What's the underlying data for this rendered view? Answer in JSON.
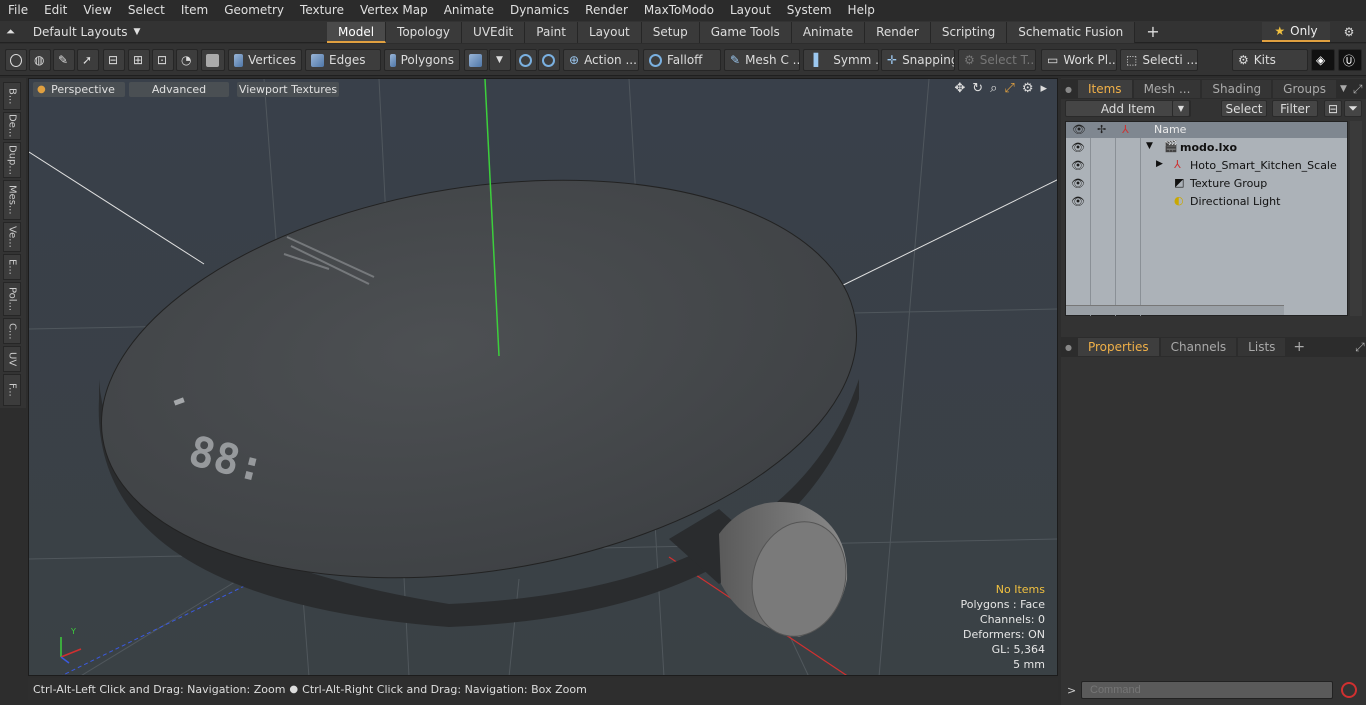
{
  "menu": [
    "File",
    "Edit",
    "View",
    "Select",
    "Item",
    "Geometry",
    "Texture",
    "Vertex Map",
    "Animate",
    "Dynamics",
    "Render",
    "MaxToModo",
    "Layout",
    "System",
    "Help"
  ],
  "layout": {
    "label": "Default Layouts"
  },
  "tabs": [
    "Model",
    "Topology",
    "UVEdit",
    "Paint",
    "Layout",
    "Setup",
    "Game Tools",
    "Animate",
    "Render",
    "Scripting",
    "Schematic Fusion"
  ],
  "only_label": "Only",
  "toolbar": {
    "vertices": "Vertices",
    "edges": "Edges",
    "polygons": "Polygons",
    "action": "Action ...",
    "falloff": "Falloff",
    "mesh": "Mesh C ...",
    "symm": "Symm ...",
    "snapping": "Snapping",
    "select_t": "Select T...",
    "work_plane": "Work Pl...",
    "selecti": "Selecti ...",
    "kits": "Kits"
  },
  "left_tabs": [
    "B...",
    "De...",
    "Dup...",
    "Mes...",
    "Ve...",
    "E...",
    "Pol...",
    "C...",
    "UV",
    "F..."
  ],
  "viewport": {
    "perspective": "Perspective",
    "advanced": "Advanced",
    "textures": "Viewport Textures",
    "info": {
      "no_items": "No Items",
      "polygons": "Polygons : Face",
      "channels": "Channels: 0",
      "deformers": "Deformers: ON",
      "gl": "GL: 5,364",
      "unit": "5 mm"
    },
    "display_text": "88:"
  },
  "status": {
    "left": "Ctrl-Alt-Left Click and Drag: Navigation: Zoom",
    "right": "Ctrl-Alt-Right Click and Drag: Navigation: Box Zoom"
  },
  "items_panel": {
    "tabs": [
      "Items",
      "Mesh ...",
      "Shading",
      "Groups"
    ],
    "add_item": "Add Item",
    "select": "Select",
    "filter": "Filter",
    "name_col": "Name",
    "rows": [
      {
        "label": "modo.lxo"
      },
      {
        "label": "Hoto_Smart_Kitchen_Scale"
      },
      {
        "label": "Texture Group"
      },
      {
        "label": "Directional Light"
      }
    ]
  },
  "props_panel": {
    "tabs": [
      "Properties",
      "Channels",
      "Lists"
    ]
  },
  "command": {
    "placeholder": "Command"
  }
}
